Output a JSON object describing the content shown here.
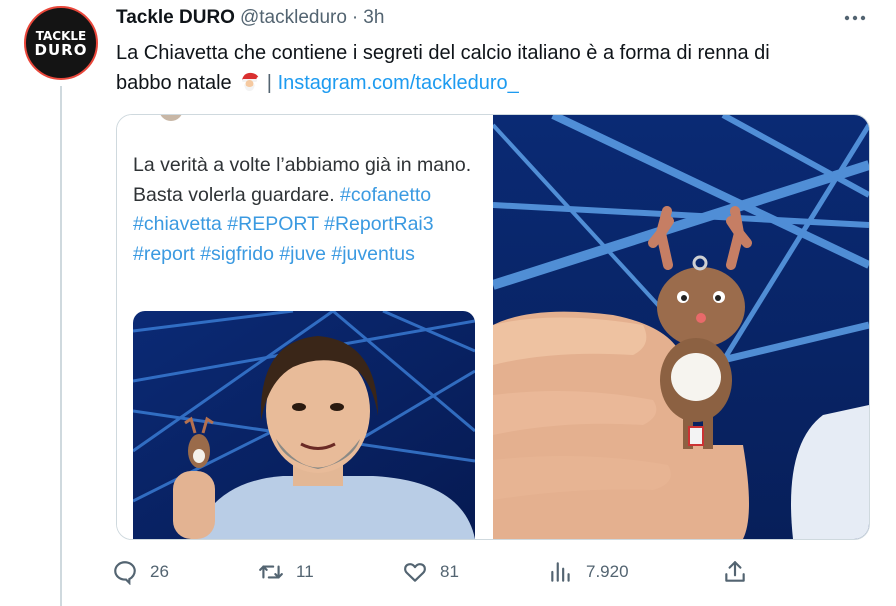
{
  "tweet": {
    "author": {
      "avatar_text_line1": "TACKLE",
      "avatar_text_line2": "DURO",
      "display_name": "Tackle DURO",
      "handle": "@tackleduro",
      "separator": "·",
      "time": "3h"
    },
    "more_icon": "more-horizontal-icon",
    "text_line1": "La Chiavetta che contiene i segreti del calcio italiano è a forma di renna di",
    "text_line2_start": "babbo natale",
    "emoji": "santa-claus-emoji",
    "text_separator": "|",
    "link_text": "Instagram.com/tackleduro_"
  },
  "media": {
    "quote_text": "La verità a volte l’abbiamo già in mano. Basta volerla guardare.",
    "quote_hashtags": "#cofanetto #chiavetta #REPORT #ReportRai3 #report #sigfrido #juve #juventus"
  },
  "actions": {
    "reply": {
      "icon": "reply-icon",
      "count": "26"
    },
    "retweet": {
      "icon": "retweet-icon",
      "count": "11"
    },
    "like": {
      "icon": "heart-icon",
      "count": "81"
    },
    "views": {
      "icon": "views-chart-icon",
      "count": "7.920"
    },
    "share": {
      "icon": "share-icon"
    }
  },
  "colors": {
    "link": "#1d9bf0",
    "secondary_text": "#536471",
    "avatar_border": "#e9473b",
    "stage_blue": "#0a2f7a"
  }
}
